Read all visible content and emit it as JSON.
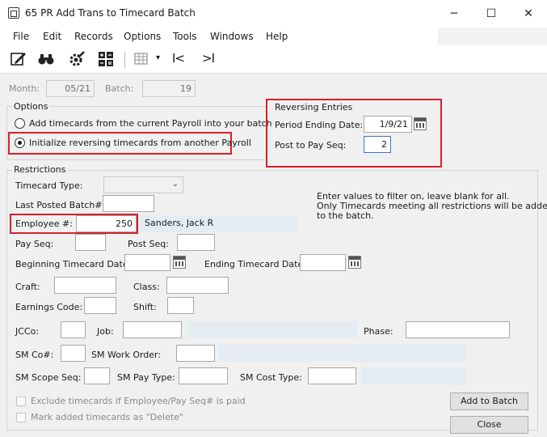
{
  "window": {
    "title": "65 PR Add Trans to Timecard Batch",
    "minimize": "─",
    "maximize": "☐",
    "close": "✕"
  },
  "menu": [
    "File",
    "Edit",
    "Records",
    "Options",
    "Tools",
    "Windows",
    "Help"
  ],
  "toolbar": {
    "icons": [
      "edit-icon",
      "binoculars-icon",
      "settings-icon",
      "calculator-icon",
      "grid-icon",
      "first-icon",
      "last-icon"
    ],
    "dropdown_arrow": "▾",
    "first": "I<",
    "last": ">I"
  },
  "header": {
    "month_label": "Month:",
    "month_value": "05/21",
    "batch_label": "Batch:",
    "batch_value": "19"
  },
  "options": {
    "title": "Options",
    "radio1": "Add timecards from the current Payroll into your batch",
    "radio2": "Initialize reversing timecards from another Payroll",
    "selected": 2
  },
  "reversing": {
    "title": "Reversing Entries",
    "period_label": "Period Ending Date:",
    "period_value": "1/9/21",
    "post_label": "Post to Pay Seq:",
    "post_value": "2"
  },
  "restrictions": {
    "title": "Restrictions",
    "timecard_type_label": "Timecard Type:",
    "last_posted_label": "Last Posted Batch#:",
    "employee_label": "Employee #:",
    "employee_value": "250",
    "employee_name": "Sanders, Jack R",
    "note_line1": "Enter values to filter on, leave blank for all.",
    "note_line2": "Only Timecards meeting all restrictions will be added",
    "note_line3": "to the batch.",
    "pay_seq_label": "Pay Seq:",
    "post_seq_label": "Post Seq:",
    "begin_date_label": "Beginning Timecard Date:",
    "end_date_label": "Ending Timecard Date:",
    "craft_label": "Craft:",
    "class_label": "Class:",
    "earnings_label": "Earnings Code:",
    "shift_label": "Shift:",
    "jcco_label": "JCCo:",
    "job_label": "Job:",
    "phase_label": "Phase:",
    "smco_label": "SM Co#:",
    "sm_work_order_label": "SM Work Order:",
    "sm_scope_label": "SM Scope Seq:",
    "sm_pay_type_label": "SM Pay Type:",
    "sm_cost_type_label": "SM Cost Type:"
  },
  "checkboxes": {
    "exclude": "Exclude timecards if Employee/Pay Seq# is paid",
    "mark_delete": "Mark added timecards as \"Delete\""
  },
  "buttons": {
    "add_to_batch": "Add to Batch",
    "close": "Close"
  },
  "colors": {
    "highlight": "#d8202a",
    "readonly_fill": "#e4ecf2",
    "focus_border": "#3c78c8"
  }
}
